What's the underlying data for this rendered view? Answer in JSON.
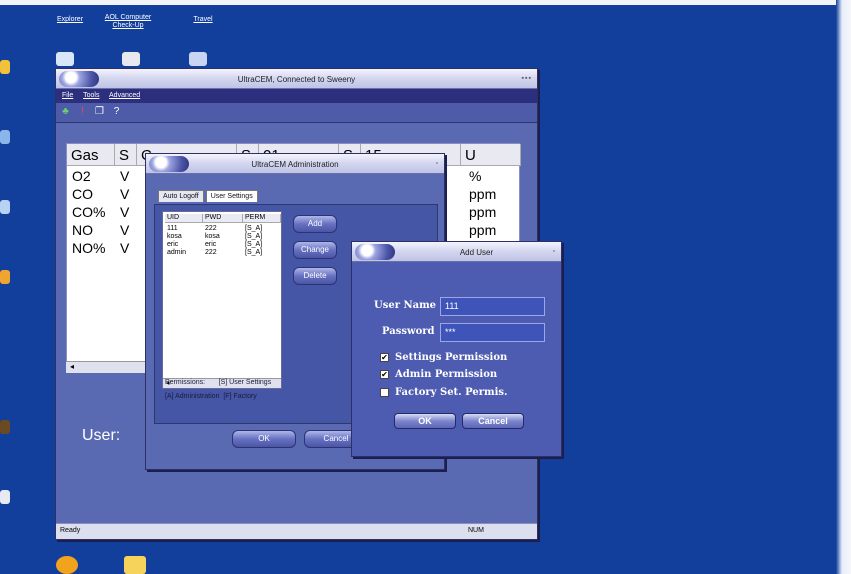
{
  "desktop": {
    "top_icons": [
      {
        "label": "Explorer",
        "name": "explorer"
      },
      {
        "label": "AOL Computer Check-Up",
        "name": "aol-checkup"
      },
      {
        "label": "Travel",
        "name": "travel"
      }
    ]
  },
  "main_window": {
    "title": "UltraCEM, Connected to Sweeny",
    "menu": [
      "File",
      "Tools",
      "Advanced"
    ],
    "grid": {
      "headers": [
        "Gas",
        "S",
        "C",
        "S",
        "01",
        "S",
        "15",
        "U"
      ],
      "rows": [
        {
          "gas": "O2",
          "s": "V",
          "unit": "%"
        },
        {
          "gas": "CO",
          "s": "V",
          "unit": "ppm"
        },
        {
          "gas": "CO%",
          "s": "V",
          "unit": "ppm"
        },
        {
          "gas": "NO",
          "s": "V",
          "unit": "ppm"
        },
        {
          "gas": "NO%",
          "s": "V",
          "unit": ""
        }
      ]
    },
    "user_label": "User:",
    "status": {
      "left": "Ready",
      "right": "NUM"
    }
  },
  "admin_dialog": {
    "title": "UltraCEM Administration",
    "tabs": [
      "Auto Logoff",
      "User Settings"
    ],
    "list_headers": [
      "UID",
      "PWD",
      "PERM"
    ],
    "users": [
      {
        "uid": "111",
        "pwd": "222",
        "perm": "[S_A]"
      },
      {
        "uid": "kosa",
        "pwd": "kosa",
        "perm": "[S_A]"
      },
      {
        "uid": "eric",
        "pwd": "eric",
        "perm": "[S_A]"
      },
      {
        "uid": "admin",
        "pwd": "222",
        "perm": "[S_A]"
      }
    ],
    "buttons": {
      "add": "Add",
      "change": "Change",
      "delete": "Delete",
      "ok": "OK",
      "cancel": "Cancel"
    },
    "legend_line1": "Permissions:       [S] User Settings",
    "legend_line2": "[A] Administration  [F] Factory"
  },
  "add_user_dialog": {
    "title": "Add User",
    "username_label": "User Name",
    "username_value": "111",
    "password_label": "Password",
    "password_value": "***",
    "checks": [
      {
        "label": "Settings Permission",
        "checked": true
      },
      {
        "label": "Admin Permission",
        "checked": true
      },
      {
        "label": "Factory Set. Permis.",
        "checked": false
      }
    ],
    "ok": "OK",
    "cancel": "Cancel"
  }
}
